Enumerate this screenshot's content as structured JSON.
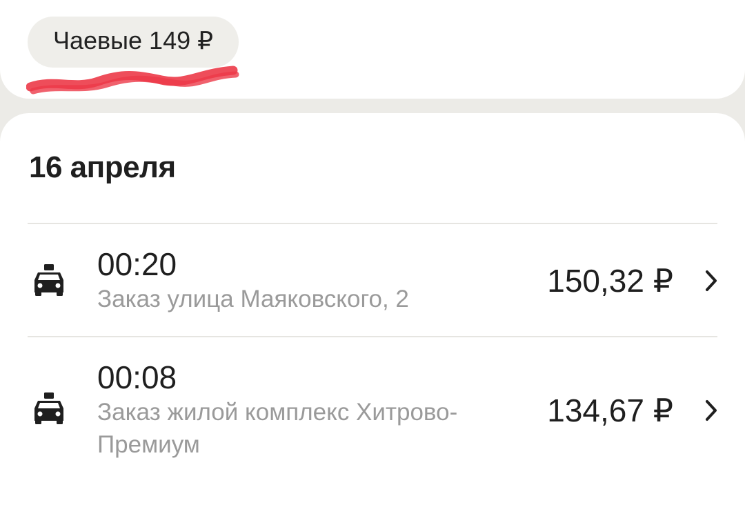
{
  "tips": {
    "label": "Чаевые 149 ₽"
  },
  "colors": {
    "background": "#ecebe7",
    "card": "#ffffff",
    "pill": "#efeeea",
    "secondary_text": "#9a9a9a",
    "redline": "#ec3a48"
  },
  "day": {
    "date": "16 апреля",
    "rides": [
      {
        "icon": "taxi-icon",
        "time": "00:20",
        "address": "Заказ улица Маяковского, 2",
        "price": "150,32 ₽"
      },
      {
        "icon": "taxi-icon",
        "time": "00:08",
        "address": "Заказ жилой комплекс Хитрово-Премиум",
        "price": "134,67 ₽"
      }
    ]
  }
}
